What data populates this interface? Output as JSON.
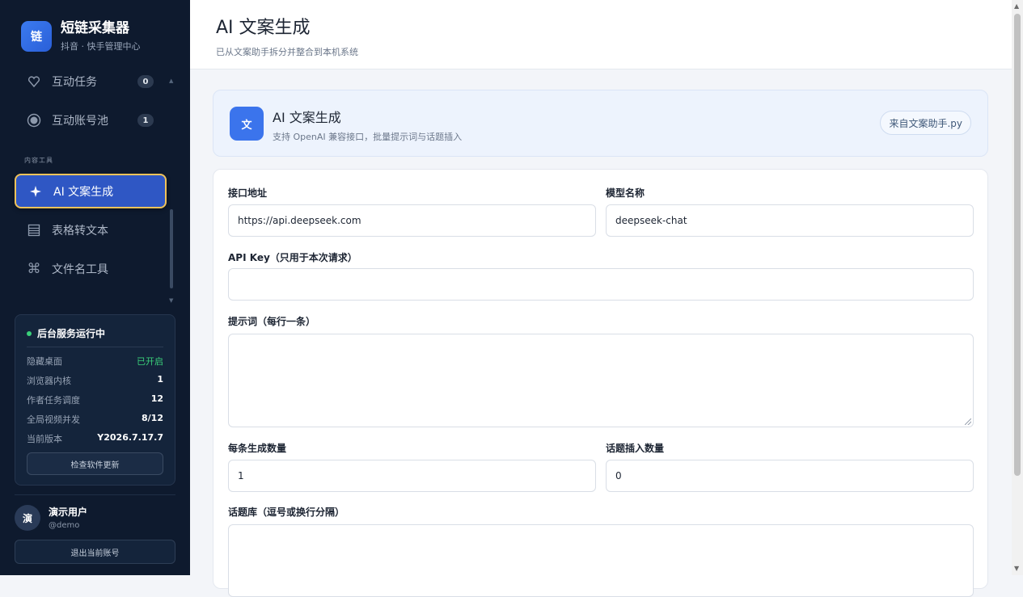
{
  "brand": {
    "logo": "链",
    "title": "短链采集器",
    "subtitle": "抖音 · 快手管理中心"
  },
  "sidebar": {
    "items": [
      {
        "label": "互动任务",
        "badge": "0",
        "icon": "heart-icon"
      },
      {
        "label": "互动账号池",
        "badge": "1",
        "icon": "record-icon"
      }
    ],
    "section_label": "内容工具",
    "tools": [
      {
        "label": "AI 文案生成",
        "icon": "sparkle-icon",
        "active": true
      },
      {
        "label": "表格转文本",
        "icon": "table-icon"
      },
      {
        "label": "文件名工具",
        "icon": "command-icon"
      }
    ]
  },
  "service": {
    "title": "后台服务运行中",
    "rows": [
      {
        "key": "隐藏桌面",
        "value": "已开启"
      },
      {
        "key": "浏览器内核",
        "value": "1"
      },
      {
        "key": "作者任务调度",
        "value": "12"
      },
      {
        "key": "全局视频并发",
        "value": "8/12"
      },
      {
        "key": "当前版本",
        "value": "Y2026.7.17.7"
      }
    ],
    "update_button": "检查软件更新"
  },
  "user": {
    "avatar": "演",
    "name": "演示用户",
    "handle": "@demo",
    "logout": "退出当前账号"
  },
  "header": {
    "title": "AI 文案生成",
    "subtitle": "已从文案助手拆分并整合到本机系统"
  },
  "hero": {
    "icon": "文",
    "title": "AI 文案生成",
    "subtitle": "支持 OpenAI 兼容接口，批量提示词与话题插入",
    "chip": "来自文案助手.py"
  },
  "form": {
    "endpoint": {
      "label": "接口地址",
      "value": "https://api.deepseek.com"
    },
    "model": {
      "label": "模型名称",
      "value": "deepseek-chat"
    },
    "api_key": {
      "label": "API Key（只用于本次请求）",
      "value": ""
    },
    "prompts": {
      "label": "提示词（每行一条）"
    },
    "count": {
      "label": "每条生成数量",
      "value": "1"
    },
    "topic_count": {
      "label": "话题插入数量",
      "value": "0"
    },
    "topics": {
      "label": "话题库（逗号或换行分隔）"
    }
  },
  "colors": {
    "accent": "#2f57c4",
    "active_border": "#f0c35a",
    "sidebar_bg": "#0e1a2e",
    "status_green": "#3ad07a"
  }
}
